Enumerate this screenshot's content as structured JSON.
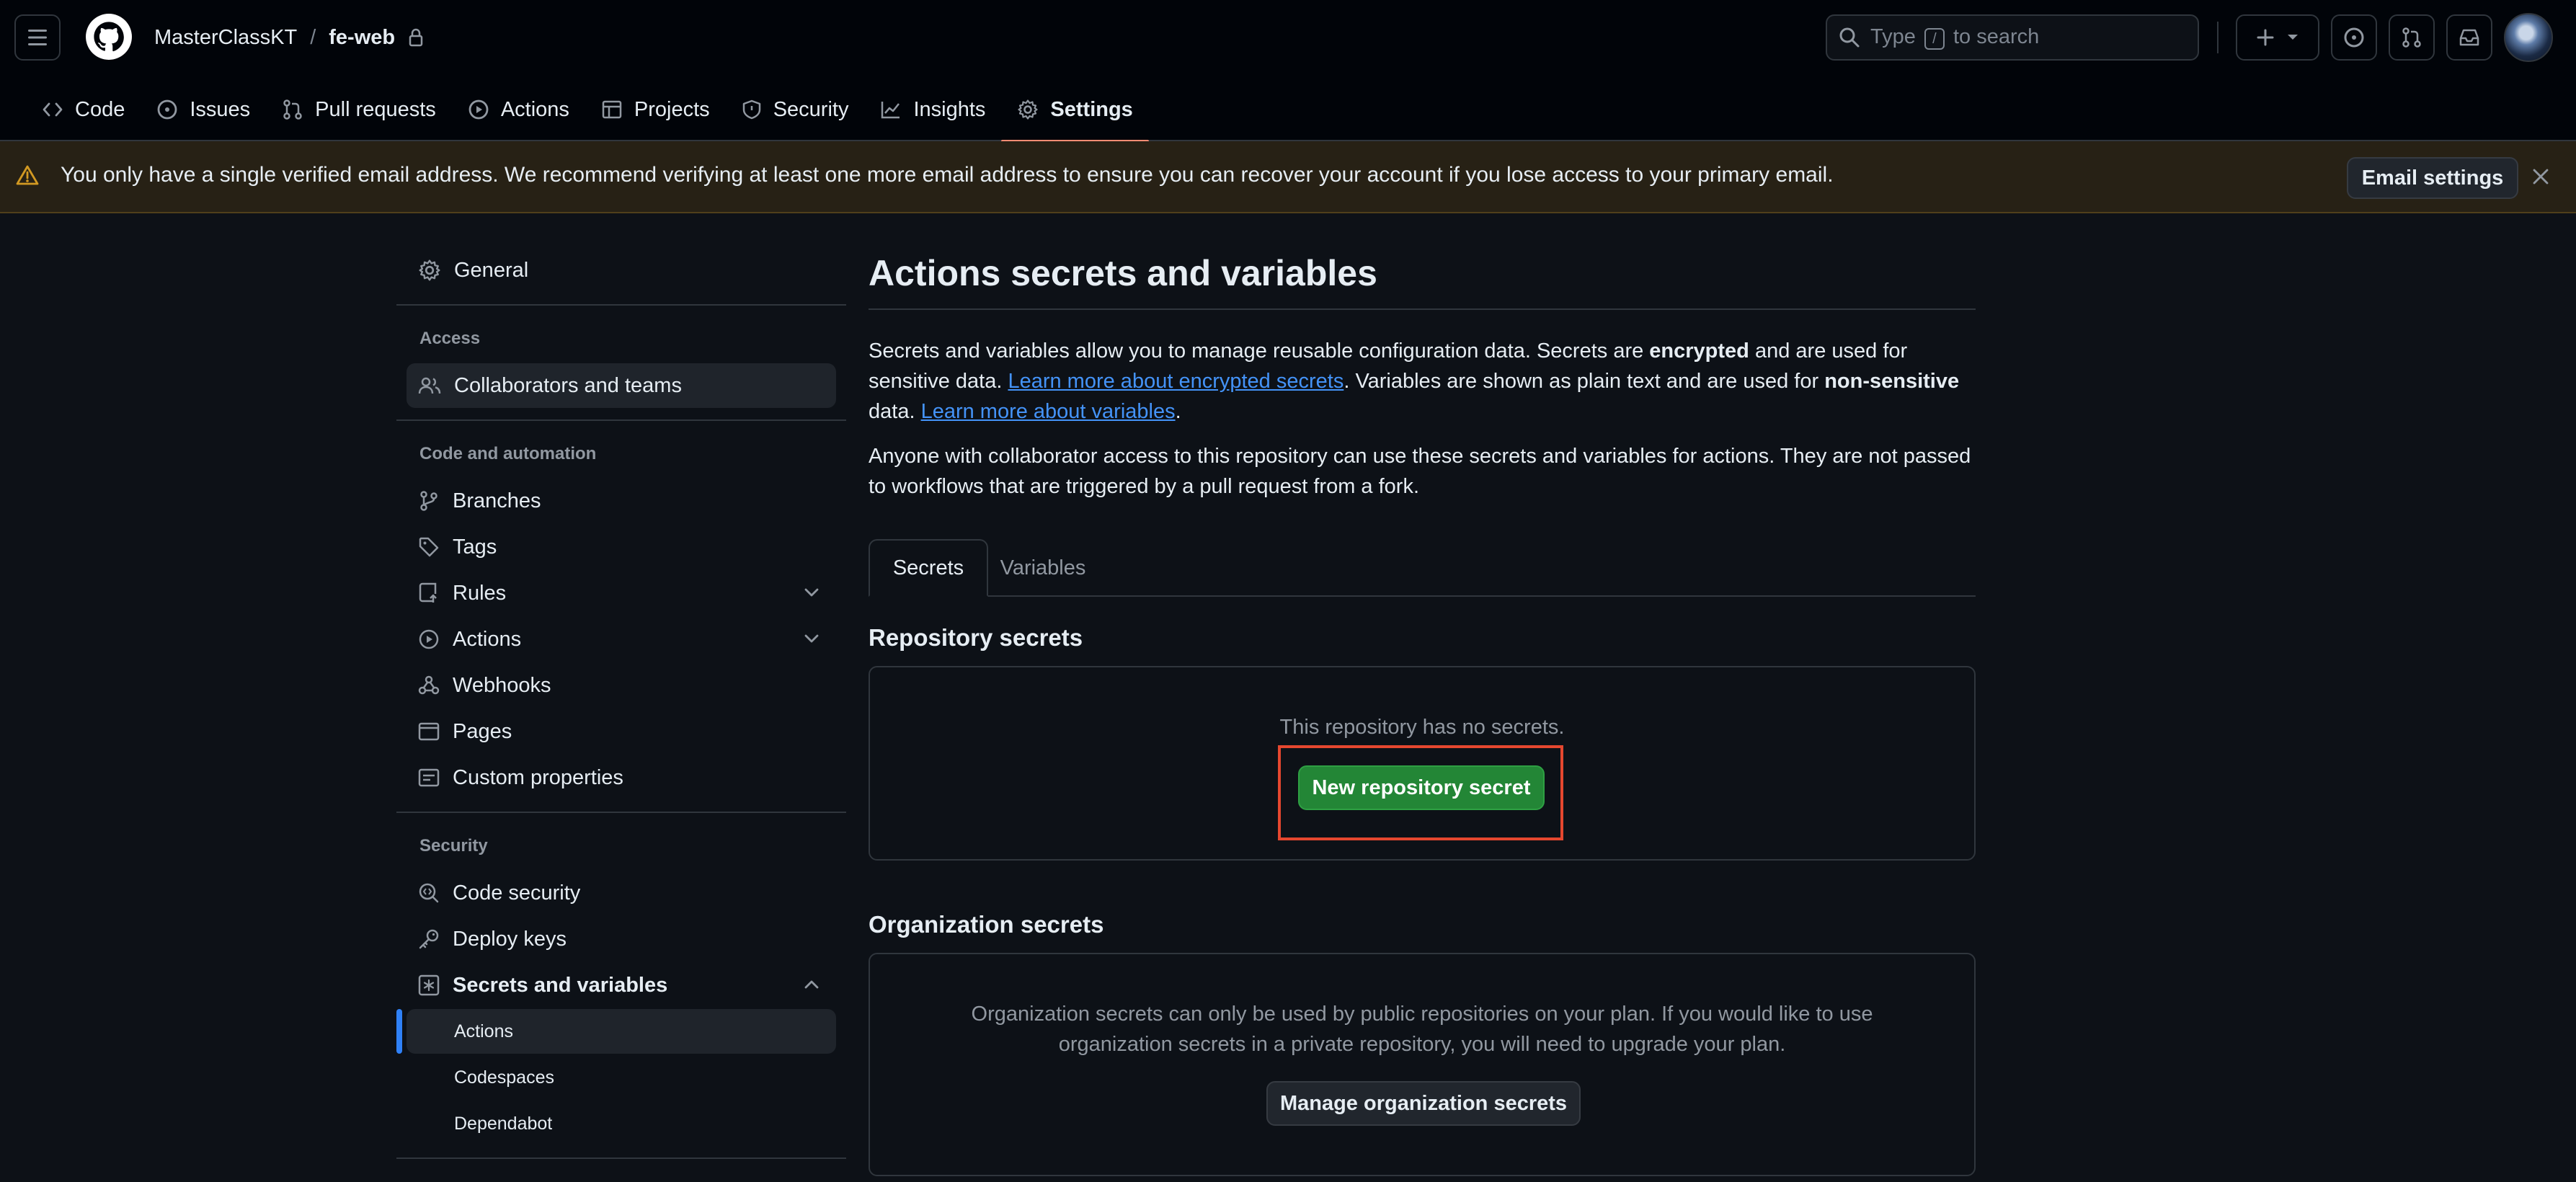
{
  "header": {
    "owner": "MasterClassKT",
    "separator": "/",
    "repo": "fe-web",
    "search": {
      "prefix": "Type",
      "key": "/",
      "suffix": "to search"
    },
    "icons": [
      "hamburger-icon",
      "github-logo",
      "lock-icon",
      "search-icon",
      "plus-icon",
      "triangle-down-icon",
      "issue-opened-icon",
      "git-pull-request-icon",
      "inbox-icon",
      "avatar"
    ]
  },
  "repo_nav": {
    "tabs": [
      {
        "label": "Code",
        "icon": "code-icon"
      },
      {
        "label": "Issues",
        "icon": "issue-opened-icon"
      },
      {
        "label": "Pull requests",
        "icon": "git-pull-request-icon"
      },
      {
        "label": "Actions",
        "icon": "play-icon"
      },
      {
        "label": "Projects",
        "icon": "table-icon"
      },
      {
        "label": "Security",
        "icon": "shield-icon"
      },
      {
        "label": "Insights",
        "icon": "graph-icon"
      },
      {
        "label": "Settings",
        "icon": "gear-icon",
        "active": true
      }
    ]
  },
  "banner": {
    "message": "You only have a single verified email address. We recommend verifying at least one more email address to ensure you can recover your account if you lose access to your primary email.",
    "button": "Email settings"
  },
  "sidebar": {
    "general": "General",
    "access_heading": "Access",
    "collaborators": "Collaborators and teams",
    "code_heading": "Code and automation",
    "branches": "Branches",
    "tags": "Tags",
    "rules": "Rules",
    "actions": "Actions",
    "webhooks": "Webhooks",
    "pages": "Pages",
    "custom_properties": "Custom properties",
    "security_heading": "Security",
    "code_security": "Code security",
    "deploy_keys": "Deploy keys",
    "secrets_and_variables": "Secrets and variables",
    "sub_actions": "Actions",
    "sub_codespaces": "Codespaces",
    "sub_dependabot": "Dependabot"
  },
  "main": {
    "title": "Actions secrets and variables",
    "intro": {
      "p1_a": "Secrets and variables allow you to manage reusable configuration data. Secrets are ",
      "p1_b": "encrypted",
      "p1_c": " and are used for sensitive data. ",
      "link1": "Learn more about encrypted secrets",
      "p1_d": ". Variables are shown as plain text and are used for ",
      "p1_e": "non-sensitive",
      "p1_f": " data. ",
      "link2": "Learn more about variables",
      "p1_g": "."
    },
    "note": "Anyone with collaborator access to this repository can use these secrets and variables for actions. They are not passed to workflows that are triggered by a pull request from a fork.",
    "tabs": [
      "Secrets",
      "Variables"
    ],
    "repo_secrets_heading": "Repository secrets",
    "no_secrets": "This repository has no secrets.",
    "new_secret_button": "New repository secret",
    "org_secrets_heading": "Organization secrets",
    "org_note_line1": "Organization secrets can only be used by public repositories on your plan. If you would like to use",
    "org_note_line2": "organization secrets in a private repository, you will need to upgrade your plan.",
    "manage_org_button": "Manage organization secrets"
  },
  "colors": {
    "bg": "#0d1117",
    "header_bg": "#010409",
    "primary_button": "#238636",
    "active_tab_underline": "#fd8c73",
    "highlight_box": "#e5472f",
    "warning": "#d29922",
    "link": "#4493f8"
  }
}
